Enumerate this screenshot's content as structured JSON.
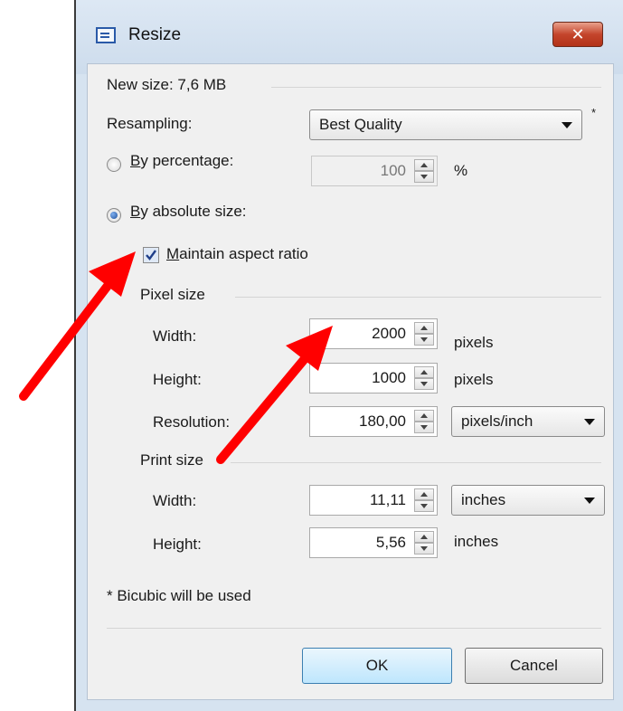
{
  "window": {
    "title": "Resize",
    "close_label": "✕"
  },
  "new_size": "New size: 7,6 MB",
  "resampling": {
    "label": "Resampling:",
    "value": "Best Quality",
    "asterisk": "*"
  },
  "by_percentage": {
    "label_first": "B",
    "label_rest": "y percentage:",
    "value": "100",
    "unit": "%"
  },
  "by_absolute": {
    "label_first": "B",
    "label_rest": "y absolute size:"
  },
  "maintain": {
    "label_first": "M",
    "label_rest": "aintain aspect ratio"
  },
  "pixel_size": {
    "header": "Pixel size",
    "width_label": "Width:",
    "width_value": "2000",
    "width_unit": "pixels",
    "height_label": "Height:",
    "height_value": "1000",
    "height_unit": "pixels",
    "resolution_label": "Resolution:",
    "resolution_value": "180,00",
    "resolution_unit": "pixels/inch"
  },
  "print_size": {
    "header": "Print size",
    "width_label": "Width:",
    "width_value": "11,11",
    "width_unit": "inches",
    "height_label": "Height:",
    "height_value": "5,56",
    "height_unit": "inches"
  },
  "footnote": "* Bicubic will be used",
  "buttons": {
    "ok": "OK",
    "cancel": "Cancel"
  },
  "colors": {
    "annotation_arrow": "#ff0000"
  }
}
